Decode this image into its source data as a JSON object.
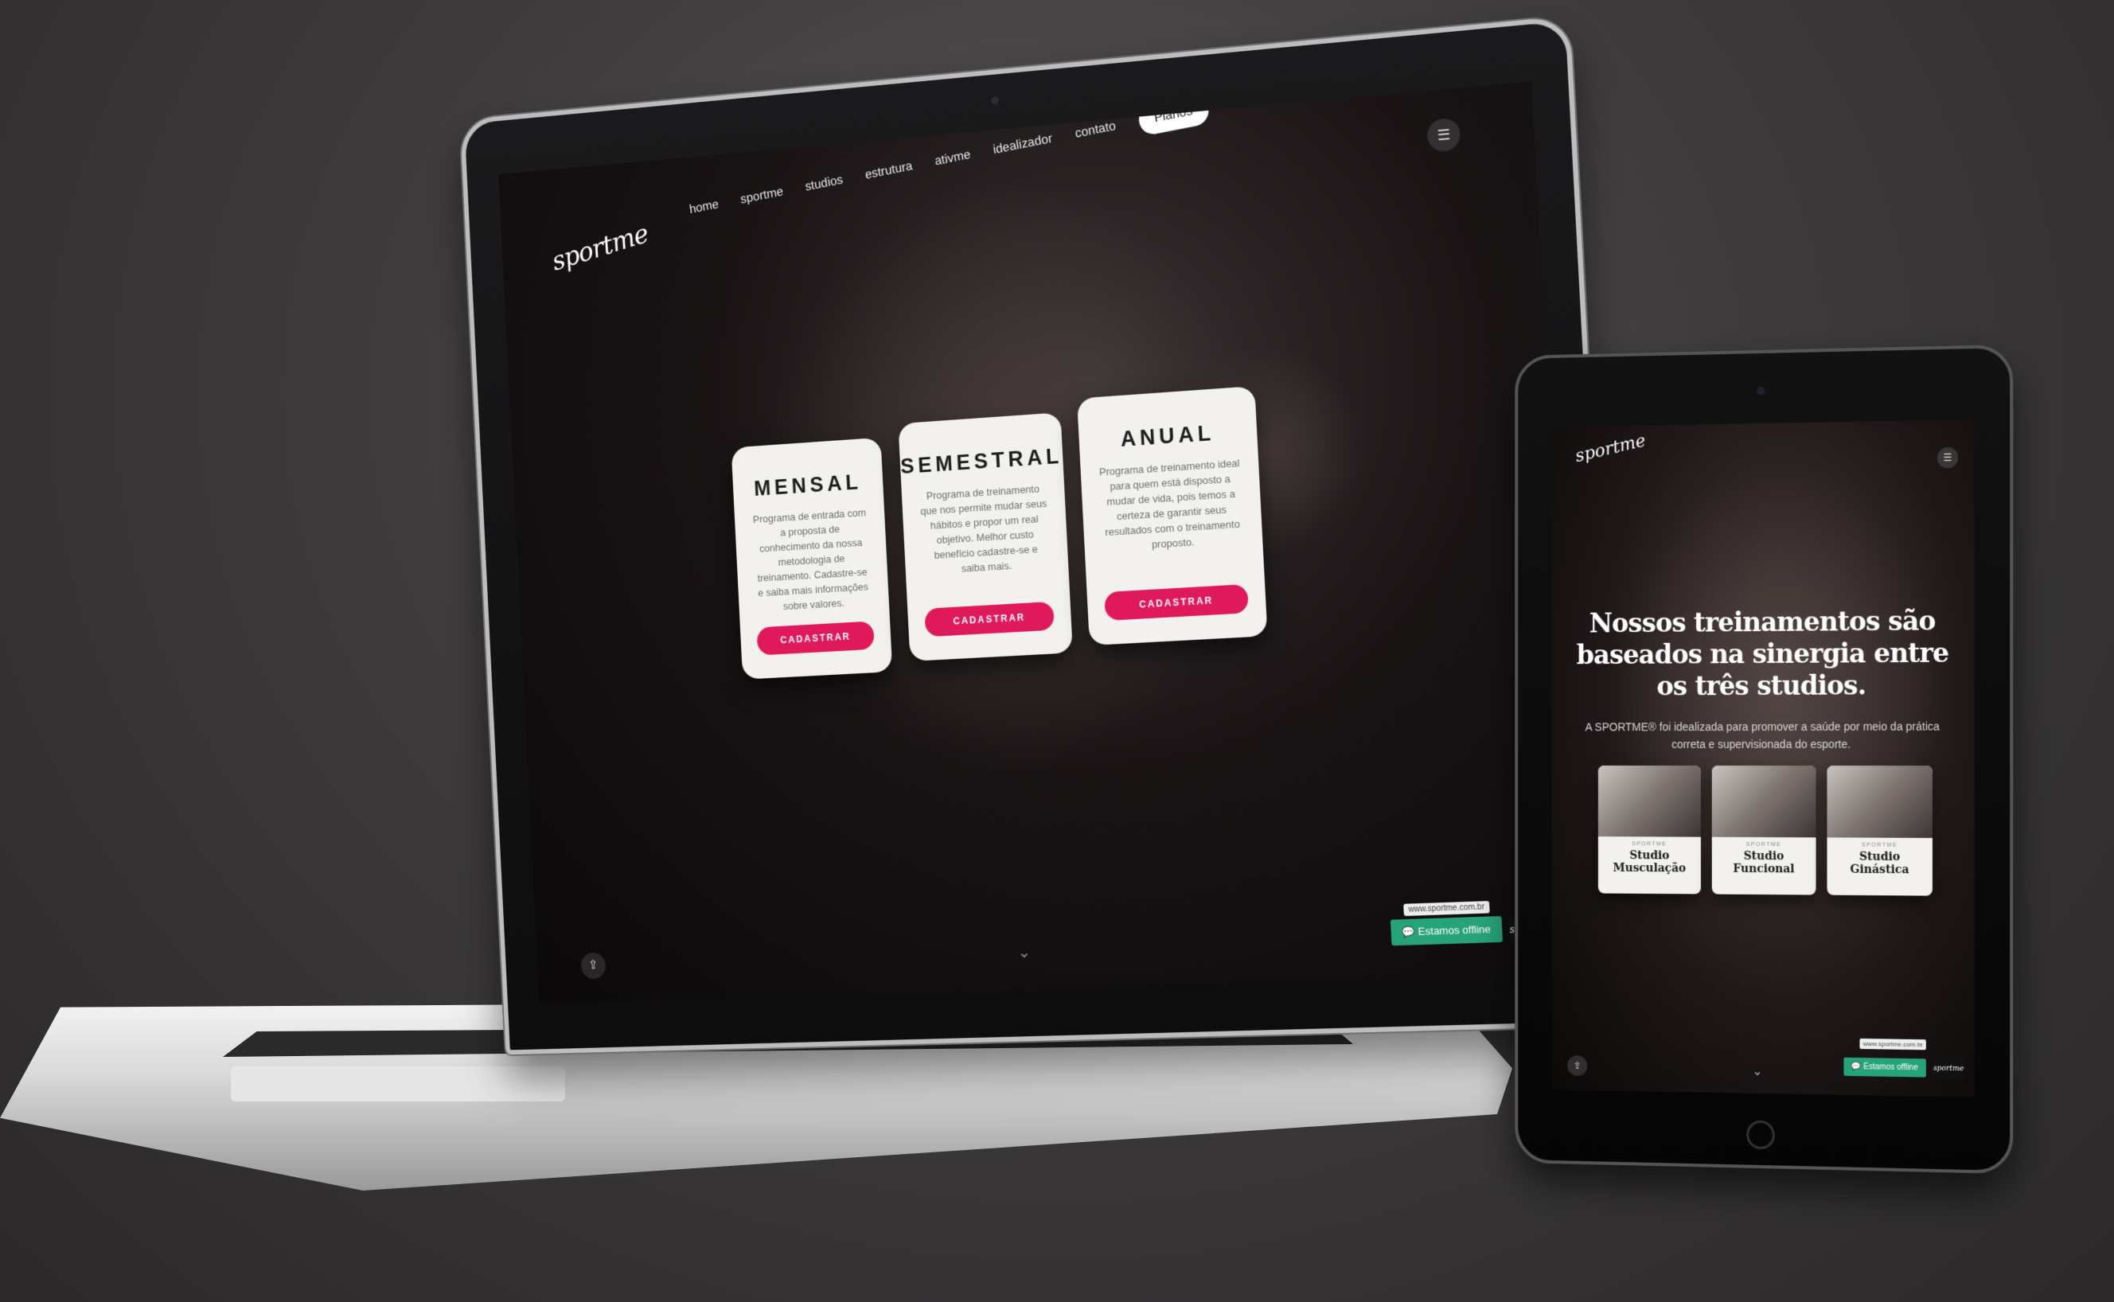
{
  "laptop": {
    "logo": "sportme",
    "nav": {
      "items": [
        "home",
        "sportme",
        "studios",
        "estrutura",
        "ativme",
        "idealizador",
        "contato"
      ],
      "cta": "Planos"
    },
    "plans": [
      {
        "title": "MENSAL",
        "description": "Programa de entrada com a proposta de conhecimento da nossa metodologia de treinamento. Cadastre-se e saiba mais informações sobre valores.",
        "button": "CADASTRAR"
      },
      {
        "title": "SEMESTRAL",
        "description": "Programa de treinamento que nos permite mudar seus hábitos e propor um real objetivo. Melhor custo benefício cadastre-se e saiba mais.",
        "button": "CADASTRAR"
      },
      {
        "title": "ANUAL",
        "description": "Programa de treinamento ideal para quem está disposto a mudar de vida, pois temos a certeza de garantir seus resultados com o treinamento proposto.",
        "button": "CADASTRAR"
      }
    ],
    "chat": {
      "url": "www.sportme.com.br",
      "label": "Estamos offline",
      "logo": "sportme"
    }
  },
  "tablet": {
    "logo": "sportme",
    "heading": "Nossos treinamentos são baseados na sinergia entre os três studios.",
    "subtitle": "A SPORTME® foi idealizada para promover a saúde por meio da prática correta e supervisionada do esporte.",
    "studios": [
      {
        "tag": "SPORTME",
        "name": "Studio Musculação"
      },
      {
        "tag": "SPORTME",
        "name": "Studio Funcional"
      },
      {
        "tag": "SPORTME",
        "name": "Studio Ginástica"
      }
    ],
    "chat": {
      "url": "www.sportme.com.br",
      "label": "Estamos offline",
      "logo": "sportme"
    }
  },
  "colors": {
    "accent": "#e0185c",
    "chat": "#27a37a",
    "card": "#f2f1ee"
  }
}
